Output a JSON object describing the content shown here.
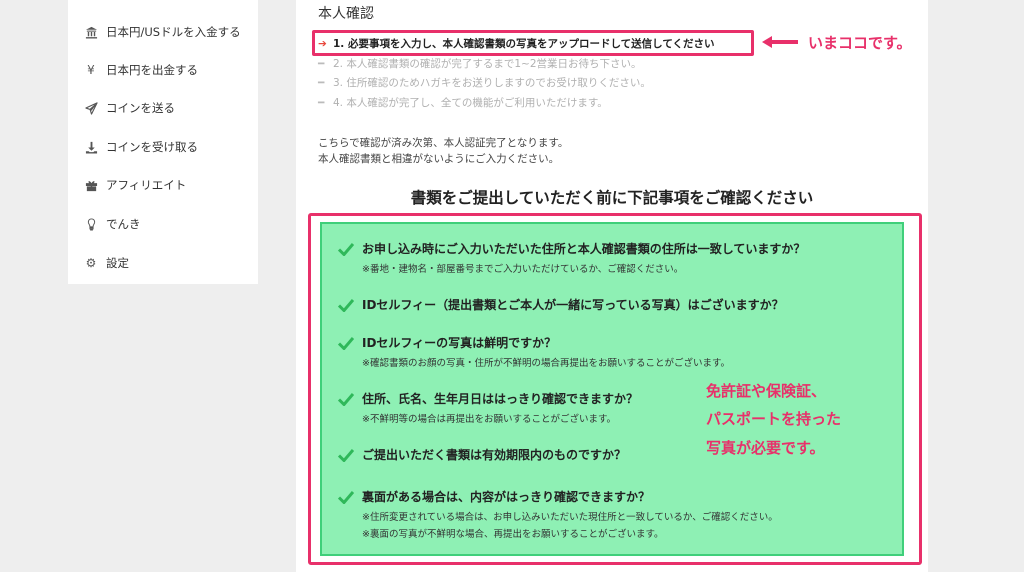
{
  "sidebar": {
    "items": [
      {
        "label": "日本円/USドルを入金する",
        "icon": "bank-icon"
      },
      {
        "label": "日本円を出金する",
        "icon": "yen-icon"
      },
      {
        "label": "コインを送る",
        "icon": "send-icon"
      },
      {
        "label": "コインを受け取る",
        "icon": "download-icon"
      },
      {
        "label": "アフィリエイト",
        "icon": "gift-icon"
      },
      {
        "label": "でんき",
        "icon": "lightbulb-icon"
      },
      {
        "label": "設定",
        "icon": "gear-icon"
      }
    ]
  },
  "main": {
    "heading": "本人確認",
    "steps": [
      "1. 必要事項を入力し、本人確認書類の写真をアップロードして送信してください",
      "2. 本人確認書類の確認が完了するまで1~2営業日お待ち下さい。",
      "3. 住所確認のためハガキをお送りしますのでお受け取りください。",
      "4. 本人確認が完了し、全ての機能がご利用いただけます。"
    ],
    "callout": "いまココです。",
    "info_line1": "こちらで確認が済み次第、本人認証完了となります。",
    "info_line2": "本人確認書類と相違がないようにご入力ください。",
    "section_title": "書類をご提出していただく前に下記事項をご確認ください",
    "checklist": [
      {
        "q": "お申し込み時にご入力いただいた住所と本人確認書類の住所は一致していますか？",
        "note": "※番地・建物名・部屋番号までご入力いただけているか、ご確認ください。",
        "note2": ""
      },
      {
        "q": "IDセルフィー（提出書類とご本人が一緒に写っている写真）はございますか？",
        "note": "",
        "note2": ""
      },
      {
        "q": "IDセルフィーの写真は鮮明ですか？",
        "note": "※確認書類のお顔の写真・住所が不鮮明の場合再提出をお願いすることがございます。",
        "note2": ""
      },
      {
        "q": "住所、氏名、生年月日ははっきり確認できますか？",
        "note": "※不鮮明等の場合は再提出をお願いすることがございます。",
        "note2": ""
      },
      {
        "q": "ご提出いただく書類は有効期限内のものですか？",
        "note": "",
        "note2": ""
      },
      {
        "q": "裏面がある場合は、内容がはっきり確認できますか？",
        "note": "※住所変更されている場合は、お申し込みいただいた現住所と一致しているか、ご確認ください。",
        "note2": "※裏面の写真が不鮮明な場合、再提出をお願いすることがございます。"
      }
    ],
    "pink_note": [
      "免許証や保険証、",
      "パスポートを持った",
      "写真が必要です。"
    ]
  },
  "colors": {
    "accent": "#e8306a",
    "check_green": "#2fb85a",
    "box_green": "#8ef0b4"
  }
}
